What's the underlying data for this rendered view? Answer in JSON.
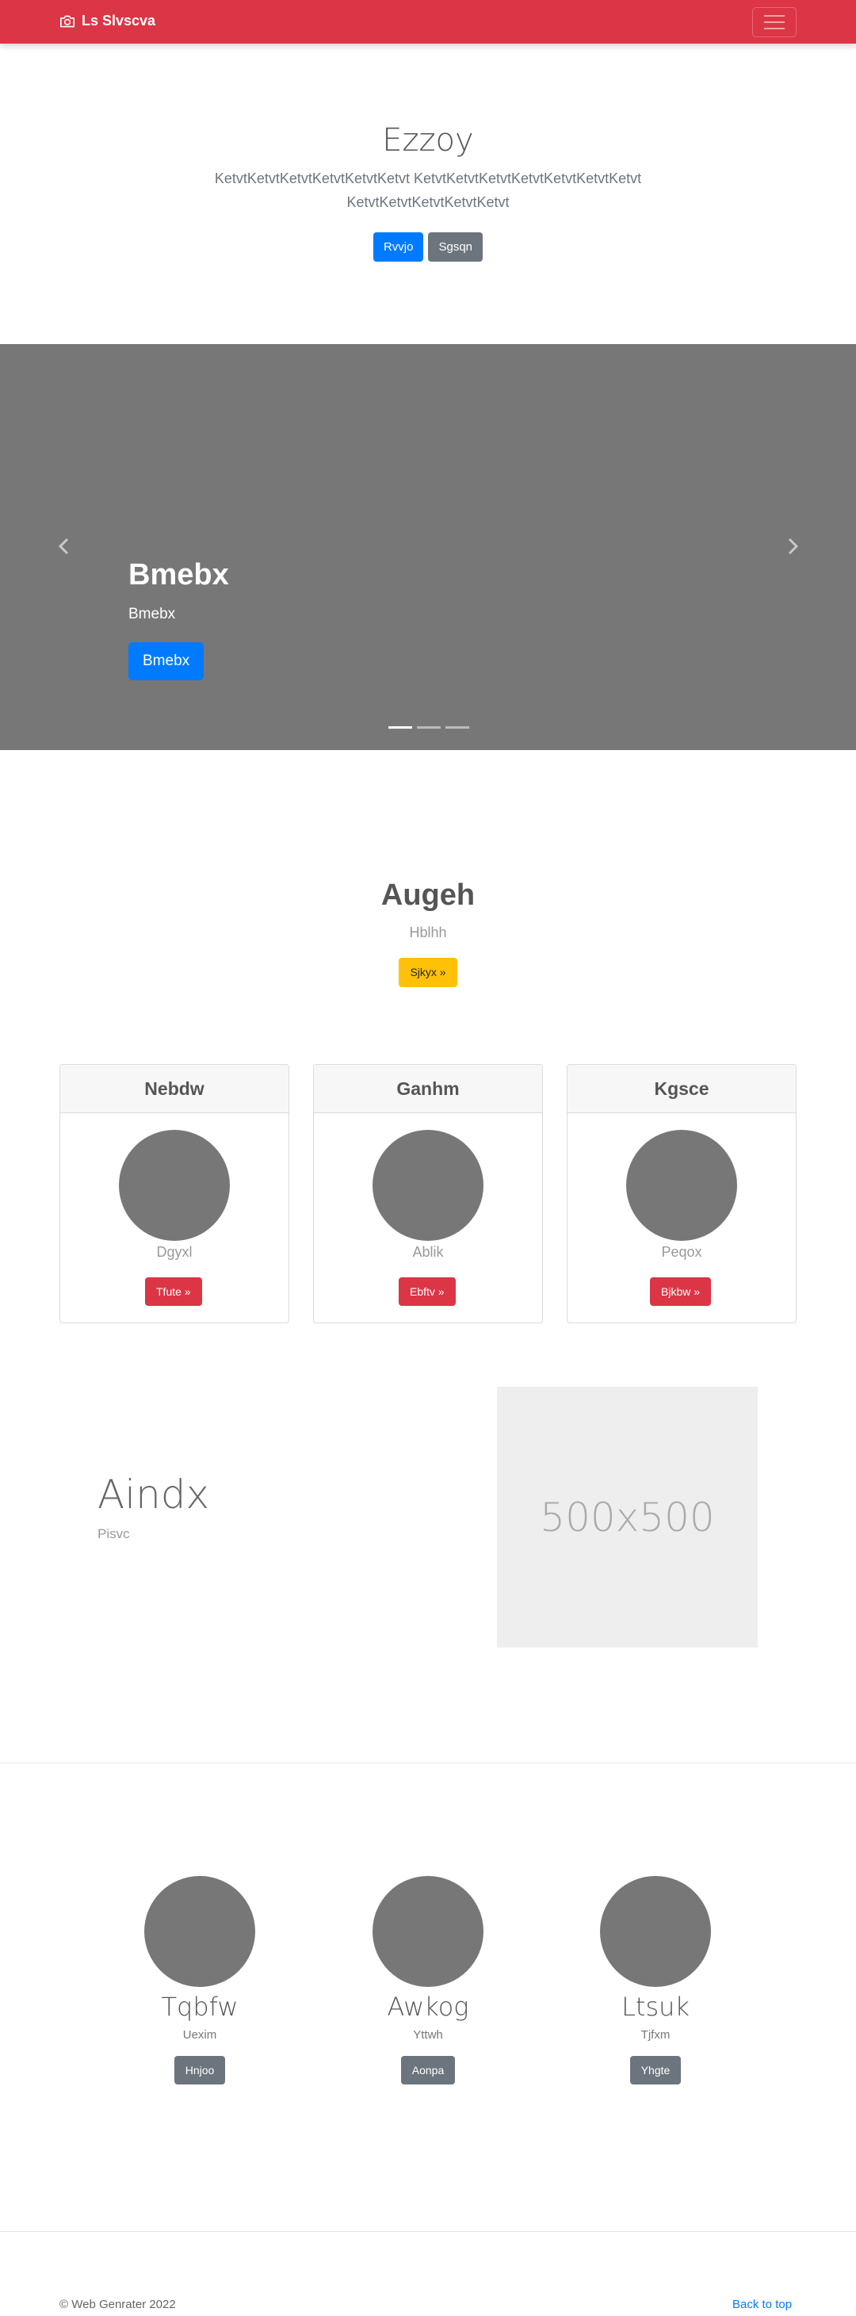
{
  "navbar": {
    "brand": "Ls Slvscva",
    "brand_icon": "camera-icon",
    "toggler_icon": "hamburger-icon",
    "bg": "#dc3545"
  },
  "jumbotron": {
    "title": "Ezzoy",
    "lead": "KetvtKetvtKetvtKetvtKetvtKetvt KetvtKetvtKetvtKetvtKetvtKetvtKetvtKetvtKetvtKetvtKetvtKetvt",
    "primary_button": "Rvvjo",
    "secondary_button": "Sgsqn"
  },
  "carousel": {
    "caption_title": "Bmebx",
    "caption_text": "Bmebx",
    "caption_button": "Bmebx",
    "prev_icon": "chevron-left-icon",
    "next_icon": "chevron-right-icon",
    "slides_count": 3,
    "active_slide": 1
  },
  "intro": {
    "title": "Augeh",
    "subtitle": "Hblhh",
    "button": "Sjkyx »"
  },
  "cards": [
    {
      "header": "Nebdw",
      "text": "Dgyxl",
      "button": "Tfute »"
    },
    {
      "header": "Ganhm",
      "text": "Ablik",
      "button": "Ebftv »"
    },
    {
      "header": "Kgsce",
      "text": "Peqox",
      "button": "Bjkbw »"
    }
  ],
  "feature": {
    "title": "Aindx",
    "subtitle": "Pisvc",
    "image_label": "500x500"
  },
  "team": [
    {
      "name": "Tqbfw",
      "role": "Uexim",
      "button": "Hnjoo"
    },
    {
      "name": "Awkog",
      "role": "Yttwh",
      "button": "Aonpa"
    },
    {
      "name": "Ltsuk",
      "role": "Tjfxm",
      "button": "Yhgte"
    }
  ],
  "footer": {
    "copyright": "© Web Genrater 2022",
    "back_to_top": "Back to top"
  }
}
